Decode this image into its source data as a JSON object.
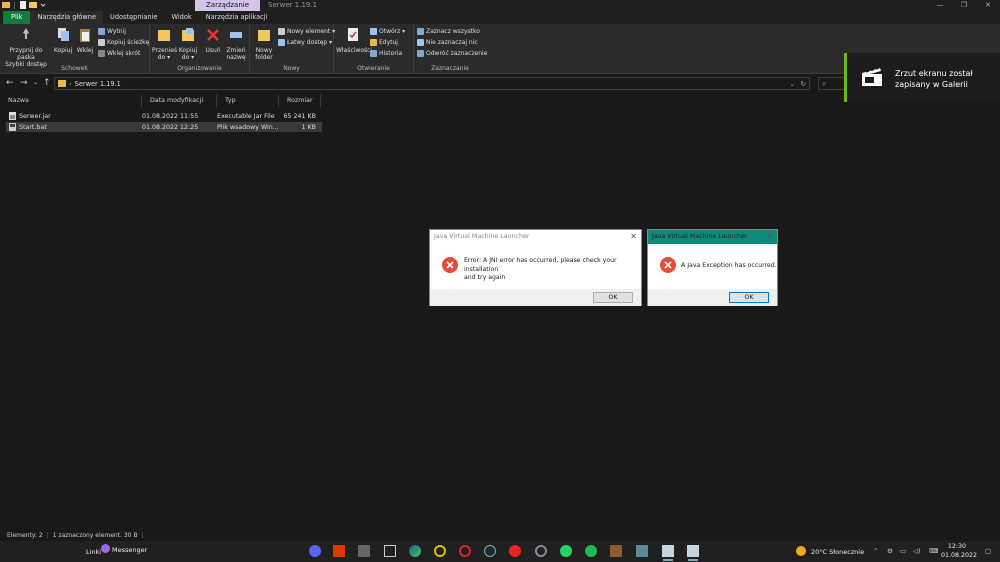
{
  "window": {
    "context_tab": "Zarządzanie",
    "title": "Serwer 1.19.1",
    "controls": [
      "—",
      "❐",
      "✕"
    ]
  },
  "ribbon_tabs": [
    "Plik",
    "Narzędzia główne",
    "Udostępnianie",
    "Widok",
    "Narzędzia aplikacji"
  ],
  "ribbon": {
    "clipboard": {
      "label": "Schowek",
      "pin_line1": "Przypnij do paska",
      "pin_line2": "Szybki dostęp",
      "copy": "Kopiuj",
      "paste": "Wklej",
      "cut": "Wytnij",
      "copy_path": "Kopiuj ścieżkę",
      "paste_shortcut": "Wklej skrót"
    },
    "organize": {
      "label": "Organizowanie",
      "move_line1": "Przenieś",
      "move_line2": "do ▾",
      "copy_line1": "Kopiuj",
      "copy_line2": "do ▾",
      "delete": "Usuń",
      "rename_line1": "Zmień",
      "rename_line2": "nazwę"
    },
    "new": {
      "label": "Nowy",
      "folder_line1": "Nowy",
      "folder_line2": "folder",
      "new_item": "Nowy element ▾",
      "easy_access": "Łatwy dostęp ▾"
    },
    "open": {
      "label": "Otwieranie",
      "properties": "Właściwości",
      "open": "Otwórz ▾",
      "edit": "Edytuj",
      "history": "Historia"
    },
    "select": {
      "label": "Zaznaczanie",
      "select_all": "Zaznacz wszystko",
      "select_none": "Nie zaznaczaj nic",
      "invert": "Odwróć zaznaczenie"
    }
  },
  "address": {
    "path": "Serwer 1.19.1",
    "search_icon": "⌕"
  },
  "columns": [
    "Nazwa",
    "Data modyfikacji",
    "Typ",
    "Rozmiar"
  ],
  "files": [
    {
      "name": "Serwer.jar",
      "date": "01.08.2022 11:55",
      "type": "Executable Jar File",
      "size": "65 241 KB"
    },
    {
      "name": "Start.bat",
      "date": "01.08.2022 12:25",
      "type": "Plik wsadowy Win...",
      "size": "1 KB"
    }
  ],
  "toast": {
    "line1": "Zrzut ekranu został",
    "line2": "zapisany w Galerii"
  },
  "dialog1": {
    "title": "Java Virtual Machine Launcher",
    "message_line1": "Error: A JNI error has occurred, please check your installation",
    "message_line2": "and try again",
    "ok": "OK"
  },
  "dialog2": {
    "title": "Java Virtual Machine Launcher",
    "message": "A Java Exception has occurred.",
    "ok": "OK"
  },
  "status": {
    "items": "Elementy: 2",
    "selected": "1 zaznaczony element. 30 B"
  },
  "taskbar": {
    "links": "Linki",
    "messenger": "Messenger",
    "weather": "20°C  Słonecznie",
    "time": "12:30",
    "date": "01.08.2022"
  },
  "colors": {
    "accent_green": "#0f7b3d",
    "context_tab": "#d6c4e8",
    "dialog_active_title": "#0f8b7a",
    "error_red": "#e84a3b"
  }
}
